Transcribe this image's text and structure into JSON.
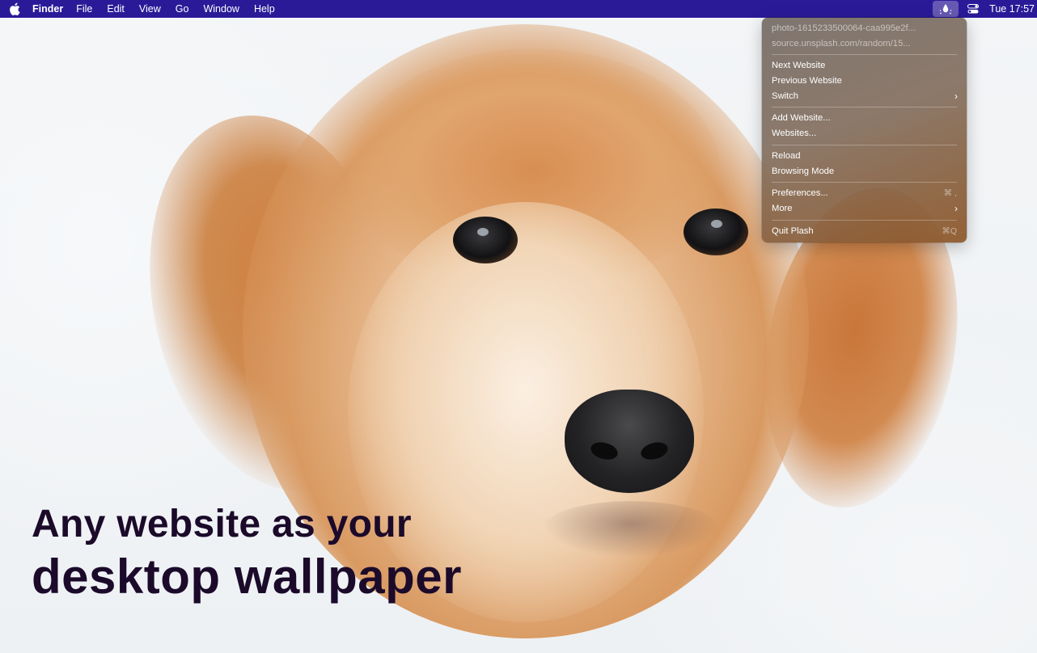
{
  "menubar": {
    "app_name": "Finder",
    "items": [
      "File",
      "Edit",
      "View",
      "Go",
      "Window",
      "Help"
    ],
    "clock": "Tue 17:57",
    "icons": [
      "apple-logo",
      "plash-icon",
      "control-center-icon"
    ]
  },
  "plash_menu": {
    "info": [
      "photo-1615233500064-caa995e2f...",
      "source.unsplash.com/random/15..."
    ],
    "groups": [
      [
        {
          "label": "Next Website"
        },
        {
          "label": "Previous Website"
        },
        {
          "label": "Switch",
          "submenu": true
        }
      ],
      [
        {
          "label": "Add Website..."
        },
        {
          "label": "Websites..."
        }
      ],
      [
        {
          "label": "Reload"
        },
        {
          "label": "Browsing Mode"
        }
      ],
      [
        {
          "label": "Preferences...",
          "shortcut": "⌘ ,"
        },
        {
          "label": "More",
          "submenu": true
        }
      ],
      [
        {
          "label": "Quit Plash",
          "shortcut": "⌘Q"
        }
      ]
    ]
  },
  "headline": {
    "line1": "Any website as your",
    "line2": "desktop wallpaper"
  },
  "colors": {
    "menubar": "#2b1a98",
    "headline": "#1b0a2a"
  }
}
